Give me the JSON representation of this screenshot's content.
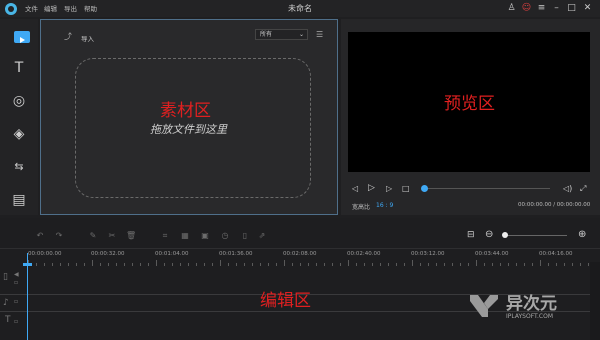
{
  "app": {
    "title": "未命名"
  },
  "menu": [
    {
      "label": "文件",
      "x_hint": 0
    },
    {
      "label": "编辑"
    },
    {
      "label": "导出"
    },
    {
      "label": "帮助"
    }
  ],
  "sidebar": {
    "items": [
      {
        "name": "media",
        "icon": "▶",
        "active": true
      },
      {
        "name": "text",
        "icon": "T"
      },
      {
        "name": "filters",
        "icon": "◎"
      },
      {
        "name": "overlays",
        "icon": "◈"
      },
      {
        "name": "transitions",
        "icon": "⇆"
      },
      {
        "name": "elements",
        "icon": "▤"
      }
    ]
  },
  "media_panel": {
    "import_label": "导入",
    "filter_value": "所有",
    "area_label": "素材区",
    "drop_hint": "拖放文件到这里"
  },
  "preview": {
    "area_label": "预览区",
    "aspect_label": "宽高比",
    "aspect_value": "16 : 9",
    "time": "00:00:00.00 / 00:00:00.00",
    "progress": 0.0
  },
  "timeline": {
    "area_label": "编辑区",
    "ruler": [
      "00:00:00.00",
      "00:00:32.00",
      "00:01:04.00",
      "00:01:36.00",
      "00:02:08.00",
      "00:02:40.00",
      "00:03:12.00",
      "00:03:44.00",
      "00:04:16.00"
    ]
  },
  "watermark": {
    "name": "异次元",
    "url": "IPLAYSOFT.COM"
  },
  "colors": {
    "accent": "#3fa9f5",
    "highlight_red": "#e02020",
    "panel_border": "#4f6f8a"
  }
}
